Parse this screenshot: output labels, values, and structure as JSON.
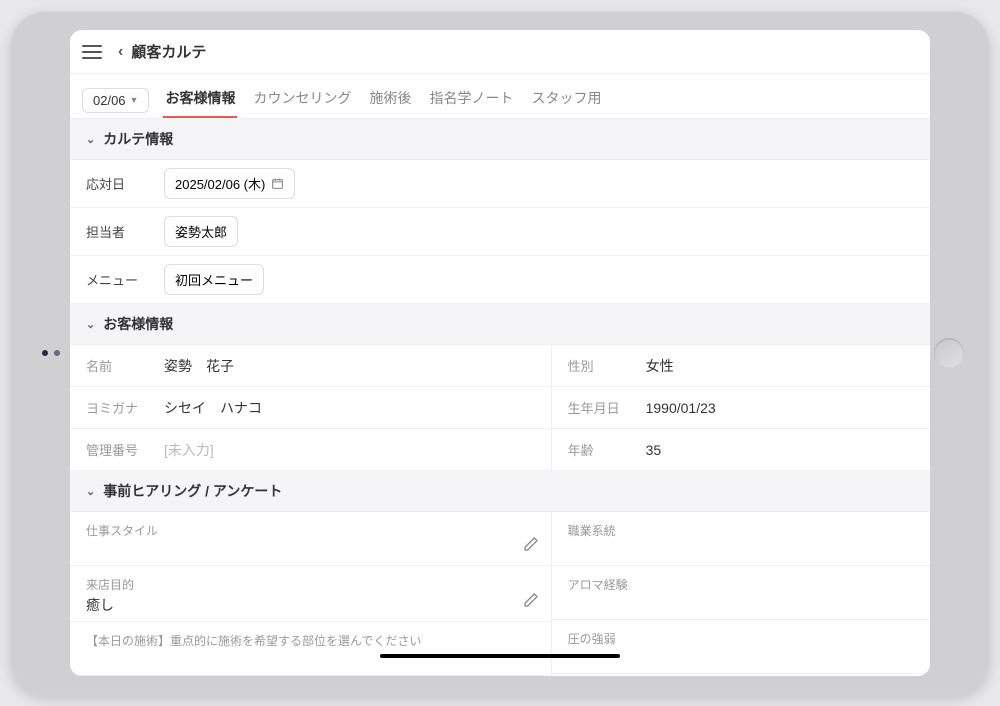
{
  "header": {
    "title": "顧客カルテ"
  },
  "dateSelect": "02/06",
  "tabs": {
    "customer": "お客様情報",
    "counseling": "カウンセリング",
    "after": "施術後",
    "notebook": "指名学ノート",
    "staff": "スタッフ用"
  },
  "sections": {
    "karte": "カルテ情報",
    "customer": "お客様情報",
    "hearing": "事前ヒアリング / アンケート"
  },
  "karte": {
    "dateLabel": "応対日",
    "dateValue": "2025/02/06 (木)",
    "staffLabel": "担当者",
    "staffValue": "姿勢太郎",
    "menuLabel": "メニュー",
    "menuValue": "初回メニュー"
  },
  "customer": {
    "nameLabel": "名前",
    "nameValue": "姿勢　花子",
    "kanaLabel": "ヨミガナ",
    "kanaValue": "シセイ　ハナコ",
    "idLabel": "管理番号",
    "idPlaceholder": "[未入力]",
    "genderLabel": "性別",
    "genderValue": "女性",
    "dobLabel": "生年月日",
    "dobValue": "1990/01/23",
    "ageLabel": "年齢",
    "ageValue": "35"
  },
  "hearing": {
    "workStyleLabel": "仕事スタイル",
    "workStyleValue": "",
    "purposeLabel": "来店目的",
    "purposeValue": "癒し",
    "todayLabel": "【本日の施術】重点的に施術を希望する部位を選んでください",
    "occupationLabel": "職業系統",
    "occupationValue": "",
    "aromaLabel": "アロマ経験",
    "aromaValue": "",
    "pressureLabel": "圧の強弱"
  }
}
